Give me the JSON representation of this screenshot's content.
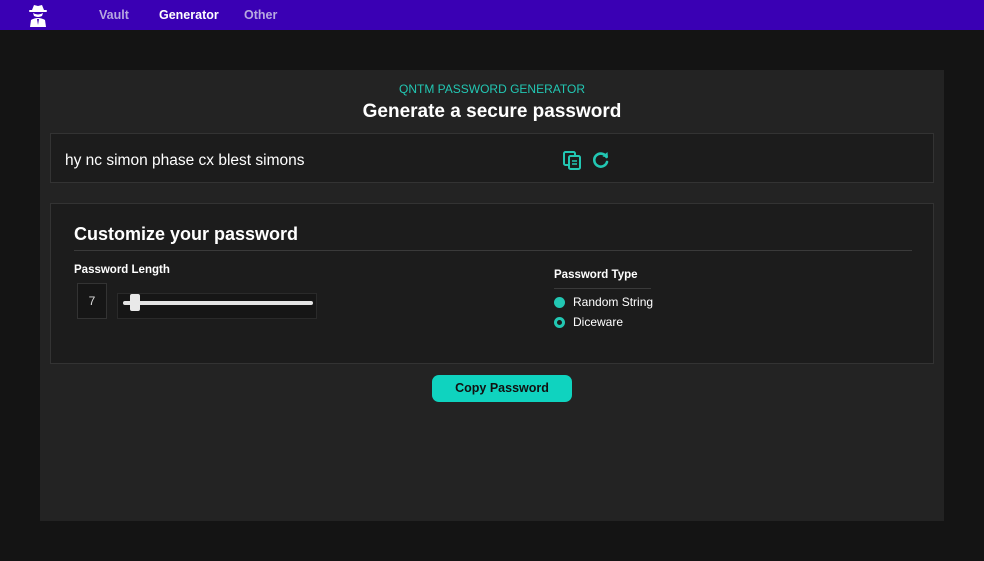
{
  "nav": {
    "items": [
      {
        "label": "Vault"
      },
      {
        "label": "Generator"
      },
      {
        "label": "Other"
      }
    ],
    "active": "Generator",
    "logo_icon": "spy-icon"
  },
  "generator": {
    "eyebrow": "QNTM PASSWORD GENERATOR",
    "title": "Generate a secure password",
    "password": "hy nc simon phase cx blest simons",
    "icons": [
      "copy-icon",
      "refresh-icon"
    ]
  },
  "customize": {
    "title": "Customize your password",
    "length_label": "Password Length",
    "length_value": "7",
    "type_label": "Password Type",
    "types": [
      {
        "label": "Random String",
        "selected": false
      },
      {
        "label": "Diceware",
        "selected": true
      }
    ]
  },
  "actions": {
    "copy_label": "Copy Password"
  },
  "colors": {
    "accent": "#22c7b3",
    "nav": "#3a00b4",
    "button": "#0fd3bf"
  }
}
